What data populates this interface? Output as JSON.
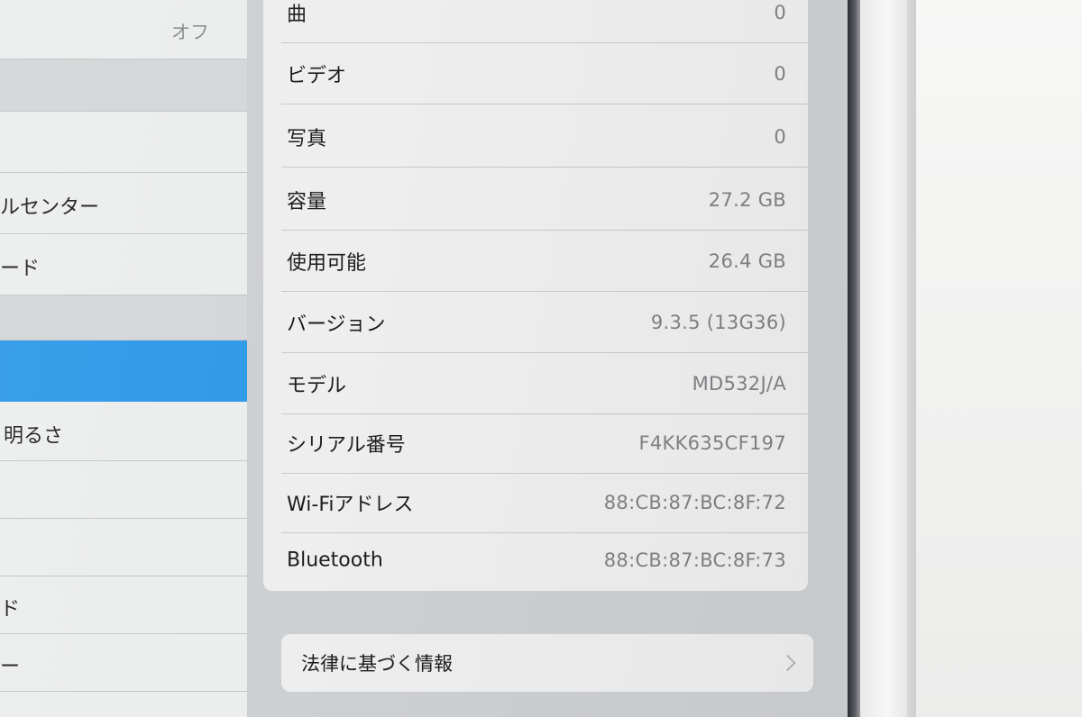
{
  "sidebar": {
    "rows": [
      {
        "label": "",
        "value": "オフ"
      },
      {
        "label": "",
        "value": ""
      },
      {
        "label": "",
        "value": ""
      },
      {
        "label": "ルセンター",
        "value": ""
      },
      {
        "label": "ード",
        "value": ""
      },
      {
        "label": "",
        "value": ""
      },
      {
        "label": "",
        "value": ""
      },
      {
        "label": "明るさ",
        "value": ""
      },
      {
        "label": "",
        "value": ""
      },
      {
        "label": "",
        "value": ""
      },
      {
        "label": "ド",
        "value": ""
      },
      {
        "label": "ー",
        "value": ""
      }
    ]
  },
  "about": {
    "rows": [
      {
        "label": "曲",
        "value": "0"
      },
      {
        "label": "ビデオ",
        "value": "0"
      },
      {
        "label": "写真",
        "value": "0"
      },
      {
        "label": "容量",
        "value": "27.2 GB"
      },
      {
        "label": "使用可能",
        "value": "26.4 GB"
      },
      {
        "label": "バージョン",
        "value": "9.3.5 (13G36)"
      },
      {
        "label": "モデル",
        "value": "MD532J/A"
      },
      {
        "label": "シリアル番号",
        "value": "F4KK635CF197"
      },
      {
        "label": "Wi-Fiアドレス",
        "value": "88:CB:87:BC:8F:72"
      },
      {
        "label": "Bluetooth",
        "value": "88:CB:87:BC:8F:73"
      }
    ]
  },
  "legal": {
    "label": "法律に基づく情報"
  },
  "colors": {
    "selection": "#2f9ae8",
    "row_background": "#eeeeee",
    "value_text": "#7f8184"
  },
  "icons": {
    "legal_chevron": "chevron-right-icon"
  }
}
